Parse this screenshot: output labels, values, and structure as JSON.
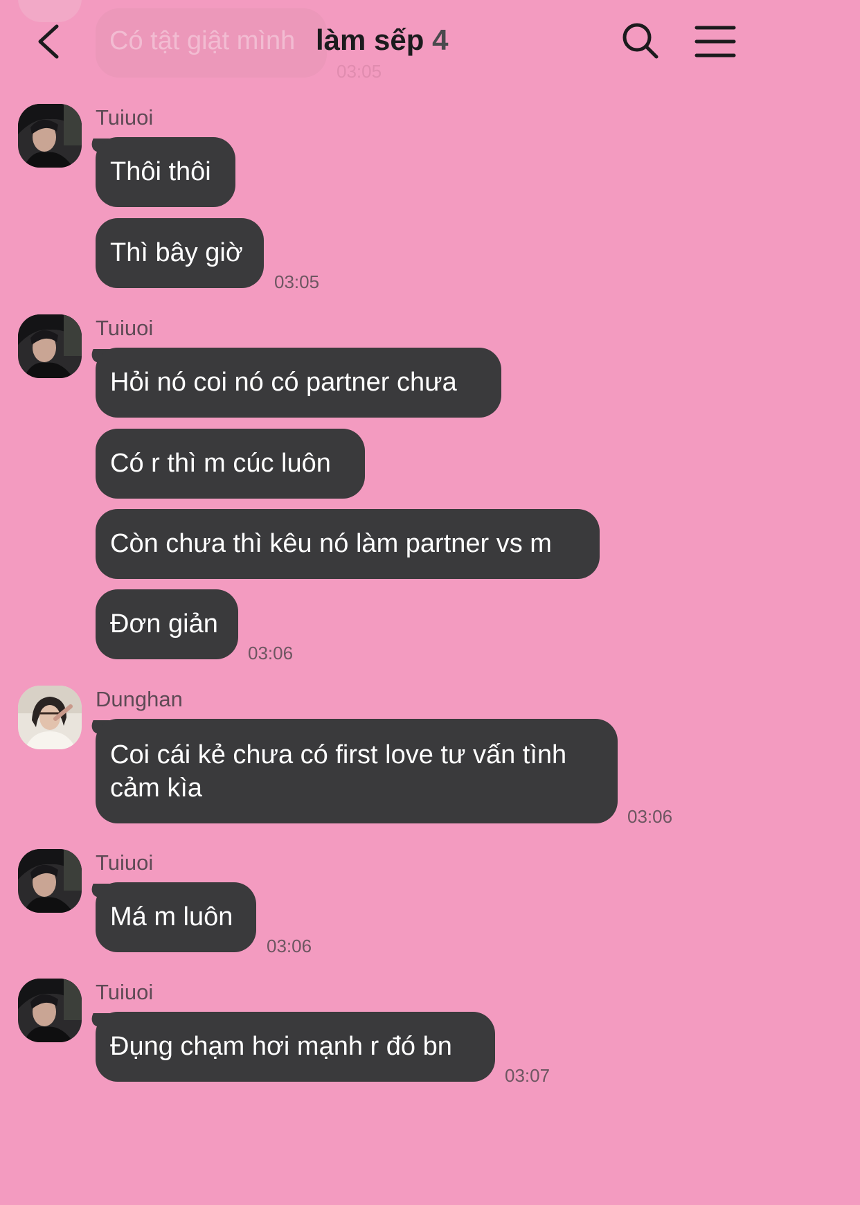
{
  "header": {
    "title": "làm sếp",
    "member_count": "4",
    "partial_message": "Có tật giật mình",
    "partial_time": "03:05"
  },
  "messages": [
    {
      "sender": "Tuiuoi",
      "texts": [
        "Thôi thôi",
        "Thì bây giờ"
      ],
      "time": "03:05"
    },
    {
      "sender": "Tuiuoi",
      "texts": [
        "Hỏi nó coi nó có partner chưa",
        "Có r thì m cúc luôn",
        "Còn chưa thì kêu nó làm partner vs m",
        "Đơn giản"
      ],
      "time": "03:06"
    },
    {
      "sender": "Dunghan",
      "texts": [
        "Coi cái kẻ chưa có first love tư vấn tình cảm kìa"
      ],
      "time": "03:06"
    },
    {
      "sender": "Tuiuoi",
      "texts": [
        "Má m luôn"
      ],
      "time": "03:06"
    },
    {
      "sender": "Tuiuoi",
      "texts": [
        "Đụng chạm hơi mạnh r đó bn"
      ],
      "time": "03:07"
    }
  ],
  "icons": {
    "back": "chevron-left-icon",
    "search": "search-icon",
    "menu": "hamburger-menu-icon"
  },
  "colors": {
    "background": "#f39bc0",
    "bubble": "#3a3a3c",
    "bubble_text": "#ffffff",
    "sender_text": "#5e4a55",
    "time_text": "#6d5661"
  }
}
